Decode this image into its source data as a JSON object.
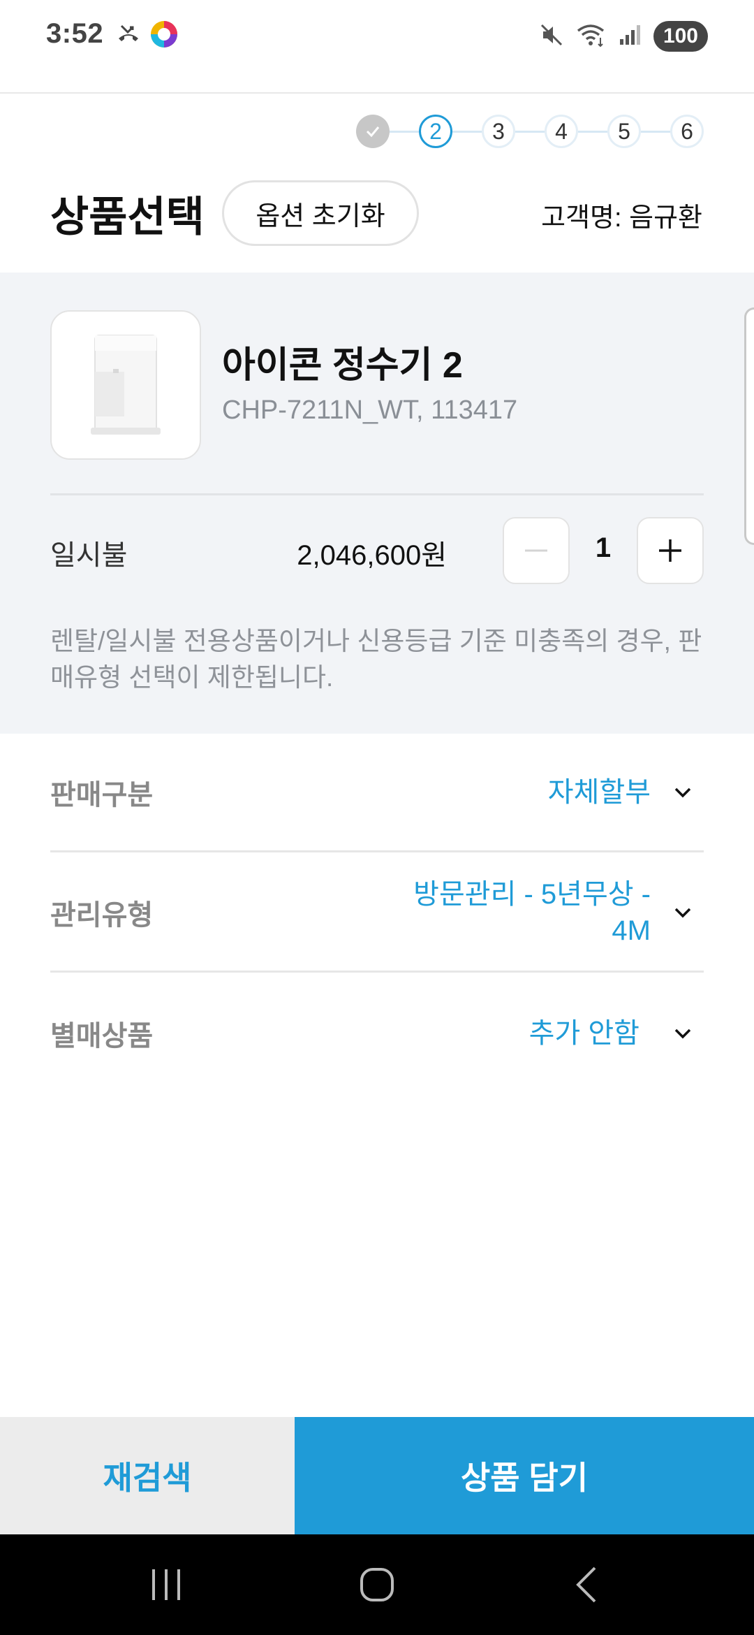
{
  "status_bar": {
    "time": "3:52",
    "battery": "100",
    "icons": [
      "missed-call-icon",
      "app-notification-icon",
      "mute-icon",
      "wifi-icon",
      "signal-icon"
    ]
  },
  "stepper": {
    "steps": [
      "✓",
      "2",
      "3",
      "4",
      "5",
      "6"
    ],
    "current_step": 2
  },
  "header": {
    "title": "상품선택",
    "reset_label": "옵션 초기화",
    "customer": "고객명: 음규환"
  },
  "product": {
    "name": "아이콘 정수기 2",
    "code": "CHP-7211N_WT, 113417",
    "pay_type": "일시불",
    "price": "2,046,600원",
    "quantity": "1",
    "notice": "렌탈/일시불 전용상품이거나 신용등급 기준 미충족의 경우, 판매유형 선택이 제한됩니다."
  },
  "options": [
    {
      "label": "판매구분",
      "value": "자체할부"
    },
    {
      "label": "관리유형",
      "value_line1": "방문관리 - 5년무상 -",
      "value_line2": "4M"
    },
    {
      "label": "별매상품",
      "value": "추가 안함"
    }
  ],
  "buttons": {
    "research": "재검색",
    "add_to_cart": "상품 담기"
  },
  "colors": {
    "accent": "#1f9bd7",
    "panel_bg": "#f2f4f7",
    "secondary_button_bg": "#ececec"
  }
}
